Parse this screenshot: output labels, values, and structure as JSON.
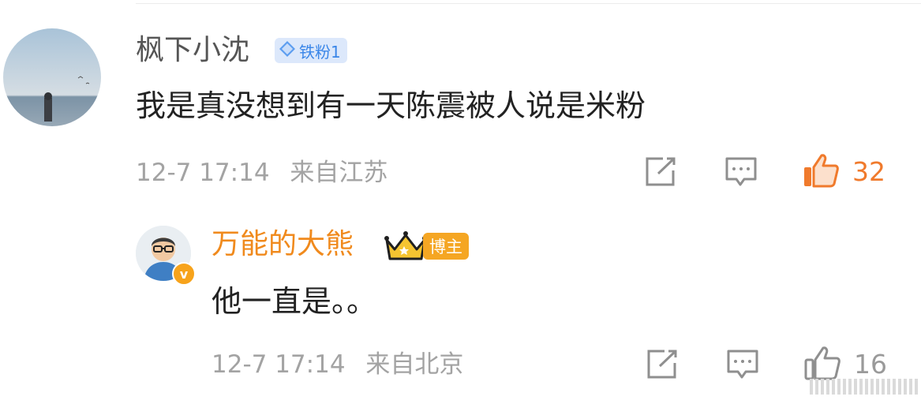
{
  "colors": {
    "username_gray": "#555555",
    "username_orange": "#f08a1d",
    "meta_gray": "#a3a3a3",
    "like_orange": "#f07a2c",
    "fan_badge_blue": "#3a86e8",
    "host_badge_orange": "#f5a623"
  },
  "comments": [
    {
      "username": "枫下小沈",
      "badge": "铁粉1",
      "text": "我是真没想到有一天陈震被人说是米粉",
      "date": "12-7 17:14",
      "location": "来自江苏",
      "likes": "32",
      "actions": [
        "share-icon",
        "comment-icon",
        "like-icon"
      ]
    },
    {
      "username": "万能的大熊",
      "badge": "博主",
      "verified_mark": "v",
      "text": "他一直是。。",
      "date": "12-7 17:14",
      "location": "来自北京",
      "likes": "16",
      "actions": [
        "share-icon",
        "comment-icon",
        "like-icon"
      ]
    }
  ]
}
